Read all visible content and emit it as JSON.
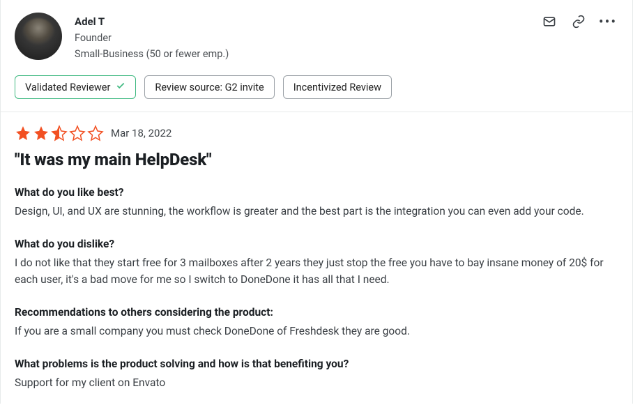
{
  "reviewer": {
    "name": "Adel T",
    "role": "Founder",
    "business": "Small-Business (50 or fewer emp.)"
  },
  "badges": {
    "validated": "Validated Reviewer",
    "source": "Review source: G2 invite",
    "incentivized": "Incentivized Review"
  },
  "rating": {
    "value": 2.5,
    "date": "Mar 18, 2022"
  },
  "title": "\"It was my main HelpDesk\"",
  "qa": {
    "q1": "What do you like best?",
    "a1": "Design, UI, and UX are stunning, the workflow is greater and the best part is the integration you can even add your code.",
    "q2": "What do you dislike?",
    "a2": "I do not like that they start free for 3 mailboxes after 2 years they just stop the free you have to bay insane money of 20$ for each user, it's a bad move for me so I switch to DoneDone it has all that I need.",
    "q3": "Recommendations to others considering the product:",
    "a3": "If you are a small company you must check DoneDone of Freshdesk they are good.",
    "q4": "What problems is the product solving and how is that benefiting you?",
    "a4": "Support for my client on Envato"
  }
}
